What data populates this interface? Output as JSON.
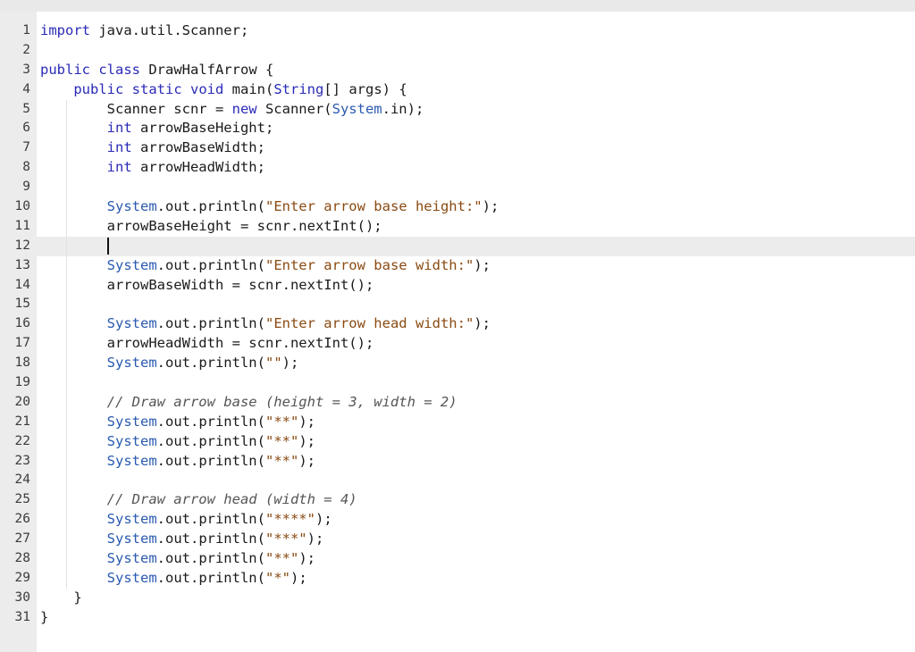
{
  "editor": {
    "active_line": 12,
    "lines": [
      {
        "n": "1",
        "tokens": [
          {
            "t": "import",
            "c": "kw"
          },
          {
            "t": " java.util.Scanner;",
            "c": ""
          }
        ]
      },
      {
        "n": "2",
        "tokens": []
      },
      {
        "n": "3",
        "tokens": [
          {
            "t": "public",
            "c": "kw"
          },
          {
            "t": " ",
            "c": ""
          },
          {
            "t": "class",
            "c": "kw"
          },
          {
            "t": " DrawHalfArrow {",
            "c": ""
          }
        ]
      },
      {
        "n": "4",
        "tokens": [
          {
            "t": "    ",
            "c": ""
          },
          {
            "t": "public",
            "c": "kw"
          },
          {
            "t": " ",
            "c": ""
          },
          {
            "t": "static",
            "c": "kw"
          },
          {
            "t": " ",
            "c": ""
          },
          {
            "t": "void",
            "c": "kw"
          },
          {
            "t": " main(",
            "c": ""
          },
          {
            "t": "String",
            "c": "ty"
          },
          {
            "t": "[] args) {",
            "c": ""
          }
        ]
      },
      {
        "n": "5",
        "tokens": [
          {
            "t": "        Scanner scnr = ",
            "c": ""
          },
          {
            "t": "new",
            "c": "kw"
          },
          {
            "t": " Scanner(",
            "c": ""
          },
          {
            "t": "System",
            "c": "sys"
          },
          {
            "t": ".in);",
            "c": ""
          }
        ]
      },
      {
        "n": "6",
        "tokens": [
          {
            "t": "        ",
            "c": ""
          },
          {
            "t": "int",
            "c": "kw"
          },
          {
            "t": " arrowBaseHeight;",
            "c": ""
          }
        ]
      },
      {
        "n": "7",
        "tokens": [
          {
            "t": "        ",
            "c": ""
          },
          {
            "t": "int",
            "c": "kw"
          },
          {
            "t": " arrowBaseWidth;",
            "c": ""
          }
        ]
      },
      {
        "n": "8",
        "tokens": [
          {
            "t": "        ",
            "c": ""
          },
          {
            "t": "int",
            "c": "kw"
          },
          {
            "t": " arrowHeadWidth;",
            "c": ""
          }
        ]
      },
      {
        "n": "9",
        "tokens": []
      },
      {
        "n": "10",
        "tokens": [
          {
            "t": "        ",
            "c": ""
          },
          {
            "t": "System",
            "c": "sys"
          },
          {
            "t": ".out.println(",
            "c": ""
          },
          {
            "t": "\"Enter arrow base height:\"",
            "c": "str"
          },
          {
            "t": ");",
            "c": ""
          }
        ]
      },
      {
        "n": "11",
        "tokens": [
          {
            "t": "        arrowBaseHeight = scnr.nextInt();",
            "c": ""
          }
        ]
      },
      {
        "n": "12",
        "tokens": [
          {
            "t": "        ",
            "c": ""
          }
        ],
        "caret": true
      },
      {
        "n": "13",
        "tokens": [
          {
            "t": "        ",
            "c": ""
          },
          {
            "t": "System",
            "c": "sys"
          },
          {
            "t": ".out.println(",
            "c": ""
          },
          {
            "t": "\"Enter arrow base width:\"",
            "c": "str"
          },
          {
            "t": ");",
            "c": ""
          }
        ]
      },
      {
        "n": "14",
        "tokens": [
          {
            "t": "        arrowBaseWidth = scnr.nextInt();",
            "c": ""
          }
        ]
      },
      {
        "n": "15",
        "tokens": []
      },
      {
        "n": "16",
        "tokens": [
          {
            "t": "        ",
            "c": ""
          },
          {
            "t": "System",
            "c": "sys"
          },
          {
            "t": ".out.println(",
            "c": ""
          },
          {
            "t": "\"Enter arrow head width:\"",
            "c": "str"
          },
          {
            "t": ");",
            "c": ""
          }
        ]
      },
      {
        "n": "17",
        "tokens": [
          {
            "t": "        arrowHeadWidth = scnr.nextInt();",
            "c": ""
          }
        ]
      },
      {
        "n": "18",
        "tokens": [
          {
            "t": "        ",
            "c": ""
          },
          {
            "t": "System",
            "c": "sys"
          },
          {
            "t": ".out.println(",
            "c": ""
          },
          {
            "t": "\"\"",
            "c": "str"
          },
          {
            "t": ");",
            "c": ""
          }
        ]
      },
      {
        "n": "19",
        "tokens": []
      },
      {
        "n": "20",
        "tokens": [
          {
            "t": "        ",
            "c": ""
          },
          {
            "t": "// Draw arrow base (height = 3, width = 2)",
            "c": "cm"
          }
        ]
      },
      {
        "n": "21",
        "tokens": [
          {
            "t": "        ",
            "c": ""
          },
          {
            "t": "System",
            "c": "sys"
          },
          {
            "t": ".out.println(",
            "c": ""
          },
          {
            "t": "\"**\"",
            "c": "str"
          },
          {
            "t": ");",
            "c": ""
          }
        ]
      },
      {
        "n": "22",
        "tokens": [
          {
            "t": "        ",
            "c": ""
          },
          {
            "t": "System",
            "c": "sys"
          },
          {
            "t": ".out.println(",
            "c": ""
          },
          {
            "t": "\"**\"",
            "c": "str"
          },
          {
            "t": ");",
            "c": ""
          }
        ]
      },
      {
        "n": "23",
        "tokens": [
          {
            "t": "        ",
            "c": ""
          },
          {
            "t": "System",
            "c": "sys"
          },
          {
            "t": ".out.println(",
            "c": ""
          },
          {
            "t": "\"**\"",
            "c": "str"
          },
          {
            "t": ");",
            "c": ""
          }
        ]
      },
      {
        "n": "24",
        "tokens": []
      },
      {
        "n": "25",
        "tokens": [
          {
            "t": "        ",
            "c": ""
          },
          {
            "t": "// Draw arrow head (width = 4)",
            "c": "cm"
          }
        ]
      },
      {
        "n": "26",
        "tokens": [
          {
            "t": "        ",
            "c": ""
          },
          {
            "t": "System",
            "c": "sys"
          },
          {
            "t": ".out.println(",
            "c": ""
          },
          {
            "t": "\"****\"",
            "c": "str"
          },
          {
            "t": ");",
            "c": ""
          }
        ]
      },
      {
        "n": "27",
        "tokens": [
          {
            "t": "        ",
            "c": ""
          },
          {
            "t": "System",
            "c": "sys"
          },
          {
            "t": ".out.println(",
            "c": ""
          },
          {
            "t": "\"***\"",
            "c": "str"
          },
          {
            "t": ");",
            "c": ""
          }
        ]
      },
      {
        "n": "28",
        "tokens": [
          {
            "t": "        ",
            "c": ""
          },
          {
            "t": "System",
            "c": "sys"
          },
          {
            "t": ".out.println(",
            "c": ""
          },
          {
            "t": "\"**\"",
            "c": "str"
          },
          {
            "t": ");",
            "c": ""
          }
        ]
      },
      {
        "n": "29",
        "tokens": [
          {
            "t": "        ",
            "c": ""
          },
          {
            "t": "System",
            "c": "sys"
          },
          {
            "t": ".out.println(",
            "c": ""
          },
          {
            "t": "\"*\"",
            "c": "str"
          },
          {
            "t": ");",
            "c": ""
          }
        ]
      },
      {
        "n": "30",
        "tokens": [
          {
            "t": "    }",
            "c": ""
          }
        ]
      },
      {
        "n": "31",
        "tokens": [
          {
            "t": "}",
            "c": ""
          }
        ]
      }
    ]
  }
}
